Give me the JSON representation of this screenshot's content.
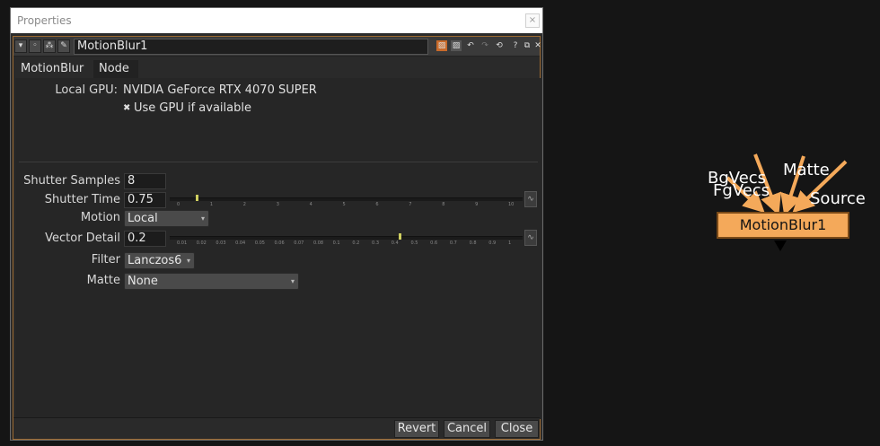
{
  "window": {
    "title": "Properties",
    "close_glyph": "×"
  },
  "node_bar": {
    "name": "MotionBlur1",
    "collapse_icon": "triangle-down-icon",
    "buttons": [
      "circle-icon",
      "dots-icon",
      "wand-icon"
    ],
    "right_icons": [
      "color-swatch-orange-icon",
      "color-swatch-icon",
      "undo-icon",
      "redo-icon",
      "revert-icon",
      "help-icon",
      "float-icon",
      "close-icon"
    ]
  },
  "tabs": [
    {
      "label": "MotionBlur"
    },
    {
      "label": "Node"
    }
  ],
  "gpu": {
    "label": "Local GPU:",
    "value": "NVIDIA GeForce RTX 4070 SUPER",
    "checkbox_label": "Use GPU if available",
    "checked": true,
    "check_glyph": "✖"
  },
  "params": {
    "shutter_samples": {
      "label": "Shutter Samples",
      "value": "8"
    },
    "shutter_time": {
      "label": "Shutter Time",
      "value": "0.75",
      "ticks": [
        "0",
        "1",
        "2",
        "3",
        "4",
        "5",
        "6",
        "7",
        "8",
        "9",
        "10"
      ],
      "fraction": 0.075
    },
    "motion": {
      "label": "Motion",
      "value": "Local"
    },
    "vector_detail": {
      "label": "Vector Detail",
      "value": "0.2",
      "ticks": [
        "0.01",
        "0.02",
        "0.03",
        "0.04",
        "0.05",
        "0.06",
        "0.07",
        "0.08",
        "0.1",
        "0.2",
        "0.3",
        "0.4",
        "0.5",
        "0.6",
        "0.7",
        "0.8",
        "0.9",
        "1"
      ],
      "fraction": 0.65
    },
    "filter": {
      "label": "Filter",
      "value": "Lanczos6"
    },
    "matte": {
      "label": "Matte",
      "value": "None"
    }
  },
  "footer": {
    "revert": "Revert",
    "cancel": "Cancel",
    "close": "Close"
  },
  "graph": {
    "node_label": "MotionBlur1",
    "inputs": [
      "BgVecs",
      "FgVecs",
      "Matte",
      "Source"
    ],
    "node_color": "#f4a95a",
    "arrow_color": "#f4a95a"
  }
}
